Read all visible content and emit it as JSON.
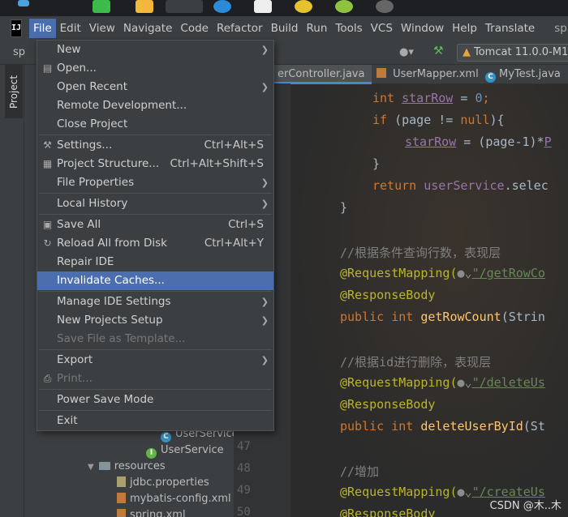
{
  "menubar": {
    "items": [
      "File",
      "Edit",
      "View",
      "Navigate",
      "Code",
      "Refactor",
      "Build",
      "Run",
      "Tools",
      "VCS",
      "Window",
      "Help",
      "Translate"
    ],
    "right_fragment": "sp"
  },
  "toolbar": {
    "breadcrumb_fragment": "sp",
    "run_config": "Tomcat 11.0.0-M1"
  },
  "tool_window": {
    "project_tab": "Project"
  },
  "editor_tabs": [
    {
      "label": "erController.java",
      "active": true
    },
    {
      "label": "UserMapper.xml",
      "active": false
    },
    {
      "label": "MyTest.java",
      "active": false
    }
  ],
  "file_menu": {
    "items": [
      {
        "label": "New",
        "shortcut": "",
        "submenu": true
      },
      {
        "label": "Open...",
        "shortcut": "",
        "submenu": false
      },
      {
        "label": "Open Recent",
        "shortcut": "",
        "submenu": true
      },
      {
        "label": "Remote Development...",
        "shortcut": "",
        "submenu": false
      },
      {
        "label": "Close Project",
        "shortcut": "",
        "submenu": false
      },
      {
        "label": "Settings...",
        "shortcut": "Ctrl+Alt+S",
        "submenu": false
      },
      {
        "label": "Project Structure...",
        "shortcut": "Ctrl+Alt+Shift+S",
        "submenu": false
      },
      {
        "label": "File Properties",
        "shortcut": "",
        "submenu": true
      },
      {
        "label": "Local History",
        "shortcut": "",
        "submenu": true
      },
      {
        "label": "Save All",
        "shortcut": "Ctrl+S",
        "submenu": false
      },
      {
        "label": "Reload All from Disk",
        "shortcut": "Ctrl+Alt+Y",
        "submenu": false
      },
      {
        "label": "Repair IDE",
        "shortcut": "",
        "submenu": false
      },
      {
        "label": "Invalidate Caches...",
        "shortcut": "",
        "submenu": false
      },
      {
        "label": "Manage IDE Settings",
        "shortcut": "",
        "submenu": true
      },
      {
        "label": "New Projects Setup",
        "shortcut": "",
        "submenu": true
      },
      {
        "label": "Save File as Template...",
        "shortcut": "",
        "submenu": false
      },
      {
        "label": "Export",
        "shortcut": "",
        "submenu": true
      },
      {
        "label": "Print...",
        "shortcut": "",
        "submenu": false
      },
      {
        "label": "Power Save Mode",
        "shortcut": "",
        "submenu": false
      },
      {
        "label": "Exit",
        "shortcut": "",
        "submenu": false
      }
    ]
  },
  "project_tree": [
    {
      "label": "UserService",
      "kind": "class"
    },
    {
      "label": "UserService",
      "kind": "interface"
    },
    {
      "label": "resources",
      "kind": "folder"
    },
    {
      "label": "jdbc.properties",
      "kind": "file"
    },
    {
      "label": "mybatis-config.xml",
      "kind": "xml"
    },
    {
      "label": "spring.xml",
      "kind": "xml"
    }
  ],
  "line_numbers": [
    "47",
    "48",
    "49",
    "50"
  ],
  "code": {
    "l1_kw": "int ",
    "l1_var": "starRow",
    "l1_rest": " = ",
    "l1_num": "0",
    "l1_end": ";",
    "l2_kw": "if ",
    "l2_a": "(page != ",
    "l2_null": "null",
    "l2_b": "){",
    "l3_var": "starRow",
    "l3_rest": " = (page-1)*",
    "l4": "}",
    "l5_kw": "return ",
    "l5_fld": "userService",
    "l5_rest": ".selec",
    "l6": "}",
    "c1": "//根据条件查询行数，表现层",
    "a1": "@RequestMapping(",
    "s1": "\"/getRowCo",
    "a2": "@ResponseBody",
    "p1_kw": "public int ",
    "p1_fn": "getRowCount",
    "p1_rest": "(Strin",
    "c2": "//根据id进行删除，表现层",
    "s2": "\"/deleteUs",
    "p2_fn": "deleteUserById",
    "p2_rest": "(St",
    "c3": "//增加",
    "s3": "\"/createUs"
  },
  "watermark": "CSDN @木..木",
  "colors": {
    "accent": "#4b6eaf",
    "background": "#2b2b2b"
  }
}
